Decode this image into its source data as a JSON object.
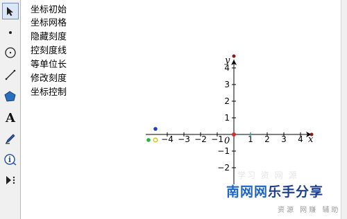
{
  "toolbar": {
    "tools": [
      {
        "name": "move-arrow-tool",
        "active": true
      },
      {
        "name": "point-tool",
        "active": false
      },
      {
        "name": "compass-tool",
        "active": false
      },
      {
        "name": "line-tool",
        "active": false
      },
      {
        "name": "polygon-tool",
        "active": false
      },
      {
        "name": "text-tool",
        "active": false
      },
      {
        "name": "marker-tool",
        "active": false
      },
      {
        "name": "information-tool",
        "active": false
      },
      {
        "name": "custom-tool",
        "active": false
      }
    ],
    "text_tool_glyph": "A",
    "info_tool_glyph": "i"
  },
  "buttons": [
    {
      "label": "坐标初始"
    },
    {
      "label": "坐标网格"
    },
    {
      "label": "隐藏刻度"
    },
    {
      "label": "控刻度线"
    },
    {
      "label": "等单位长"
    },
    {
      "label": "修改刻度"
    },
    {
      "label": "坐标控制"
    }
  ],
  "axes": {
    "x_name": "x",
    "y_name": "y",
    "origin_label": "0",
    "x_ticks": [
      -4,
      -3,
      -2,
      -1,
      1,
      2,
      3,
      4
    ],
    "y_ticks": [
      -2,
      -1,
      1,
      2,
      3,
      4
    ],
    "x_tick_labels": [
      "−4",
      "−3",
      "−2",
      "−1",
      "1",
      "2",
      "3",
      "4"
    ],
    "y_tick_labels": [
      "−2",
      "−1",
      "1",
      "2",
      "3",
      "4"
    ]
  },
  "colors": {
    "axis": "#000000",
    "origin_point": "#d03030",
    "axis_endpoint": "#8b1a1a",
    "control_blue": "#1f3fbf",
    "control_green": "#2bb03c",
    "control_yellow": "#d8c000",
    "teal_tick": "#3aa0a0"
  },
  "watermark": {
    "brand_1": "南网网",
    "brand_2": "乐手分享",
    "sub": "资源 网赚 辅助",
    "ghost": "学习 资 网 源"
  }
}
